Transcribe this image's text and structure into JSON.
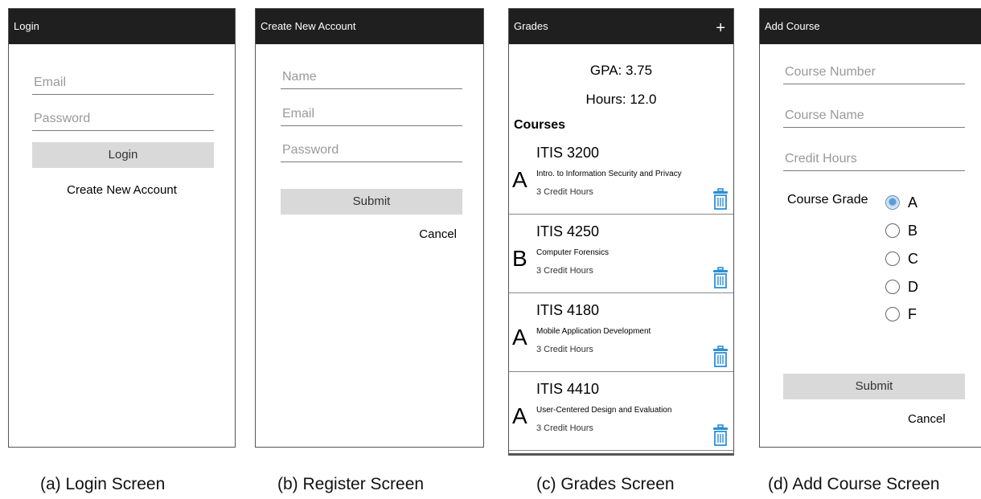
{
  "login": {
    "title": "Login",
    "email_placeholder": "Email",
    "password_placeholder": "Password",
    "login_label": "Login",
    "create_label": "Create New Account",
    "caption": "(a) Login Screen"
  },
  "register": {
    "title": "Create New Account",
    "name_placeholder": "Name",
    "email_placeholder": "Email",
    "password_placeholder": "Password",
    "submit_label": "Submit",
    "cancel_label": "Cancel",
    "caption": "(b) Register Screen"
  },
  "grades": {
    "title": "Grades",
    "add_icon": "+",
    "gpa": "GPA: 3.75",
    "hours": "Hours: 12.0",
    "courses_heading": "Courses",
    "courses": [
      {
        "number": "ITIS 3200",
        "grade": "A",
        "name": "Intro. to Information Security and Privacy",
        "hours": "3 Credit Hours"
      },
      {
        "number": "ITIS 4250",
        "grade": "B",
        "name": "Computer Forensics",
        "hours": "3 Credit Hours"
      },
      {
        "number": "ITIS 4180",
        "grade": "A",
        "name": "Mobile Application Development",
        "hours": "3 Credit Hours"
      },
      {
        "number": "ITIS 4410",
        "grade": "A",
        "name": "User-Centered Design and Evaluation",
        "hours": "3 Credit Hours"
      }
    ],
    "caption": "(c) Grades Screen"
  },
  "add_course": {
    "title": "Add Course",
    "number_placeholder": "Course Number",
    "name_placeholder": "Course Name",
    "hours_placeholder": "Credit Hours",
    "grade_label": "Course Grade",
    "grades": [
      "A",
      "B",
      "C",
      "D",
      "F"
    ],
    "selected_grade": "A",
    "submit_label": "Submit",
    "cancel_label": "Cancel",
    "caption": "(d) Add Course Screen"
  },
  "colors": {
    "topbar": "#1f1f1f",
    "button": "#d9d9d9",
    "trash_icon": "#2b8fd6"
  }
}
